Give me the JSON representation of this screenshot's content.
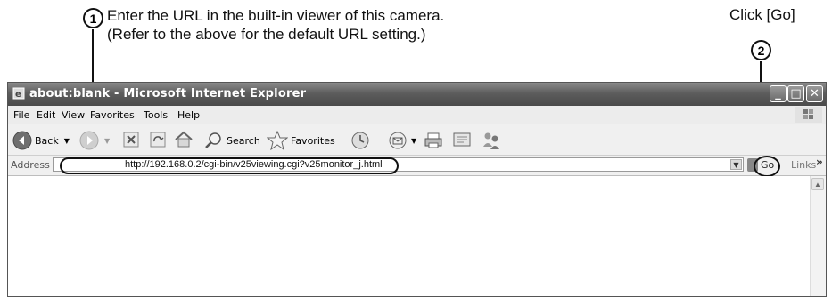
{
  "annotations": {
    "step1_number": "1",
    "step1_line1": "Enter the URL in the built-in viewer of this camera.",
    "step1_line2": "(Refer to the above for the default URL setting.)",
    "step2_number": "2",
    "step2_label": "Click [Go]"
  },
  "window": {
    "title": "about:blank - Microsoft Internet Explorer",
    "minimize": "_",
    "maximize": "□",
    "close": "✕"
  },
  "menu": {
    "items": [
      "File",
      "Edit",
      "View",
      "Favorites",
      "Tools",
      "Help"
    ]
  },
  "toolbar": {
    "back_label": "Back",
    "search_label": "Search",
    "favorites_label": "Favorites"
  },
  "address_bar": {
    "label": "Address",
    "url": "http://192.168.0.2/cgi-bin/v25viewing.cgi?v25monitor_j.html",
    "go_label": "Go",
    "links_label": "Links",
    "links_chevron": "»"
  },
  "icons": [
    "ie-icon",
    "back-icon",
    "forward-icon",
    "stop-icon",
    "refresh-icon",
    "home-icon",
    "search-icon",
    "favorites-icon",
    "history-icon",
    "mail-icon",
    "print-icon",
    "edit-icon",
    "messenger-icon",
    "windows-flag-icon"
  ]
}
